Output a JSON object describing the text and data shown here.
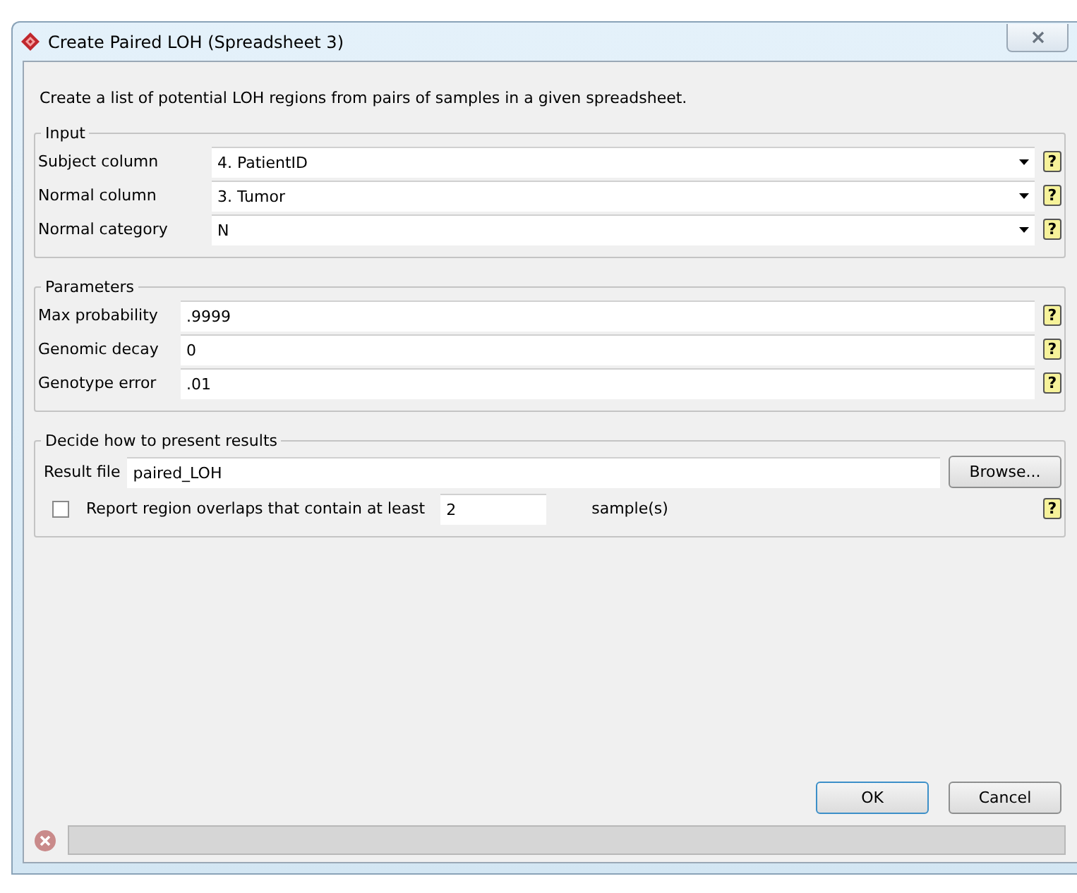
{
  "window": {
    "title": "Create Paired LOH (Spreadsheet 3)"
  },
  "description": "Create a list of potential LOH regions from pairs of samples in a given spreadsheet.",
  "groups": [
    {
      "title": "Input",
      "fields": [
        {
          "kind": "dropdown",
          "label": "Subject column",
          "value": "4. PatientID",
          "help": "?"
        },
        {
          "kind": "dropdown",
          "label": "Normal column",
          "value": "3. Tumor",
          "help": "?"
        },
        {
          "kind": "dropdown",
          "label": "Normal category",
          "value": "N",
          "help": "?"
        }
      ]
    },
    {
      "title": "Parameters",
      "fields": [
        {
          "kind": "text",
          "label": "Max probability",
          "value": ".9999",
          "help": "?"
        },
        {
          "kind": "text",
          "label": "Genomic decay",
          "value": "0",
          "help": "?"
        },
        {
          "kind": "text",
          "label": "Genotype error",
          "value": ".01",
          "help": "?"
        }
      ]
    }
  ],
  "results": {
    "title": "Decide how to present results",
    "file_label": "Result file",
    "file_value": "paired_LOH",
    "browse": "Browse...",
    "overlap": {
      "checked": false,
      "label": "Report region overlaps that contain at least",
      "value": "2",
      "suffix": "sample(s)",
      "help": "?"
    }
  },
  "buttons": [
    {
      "label": "OK",
      "default": true
    },
    {
      "label": "Cancel",
      "default": false
    }
  ]
}
